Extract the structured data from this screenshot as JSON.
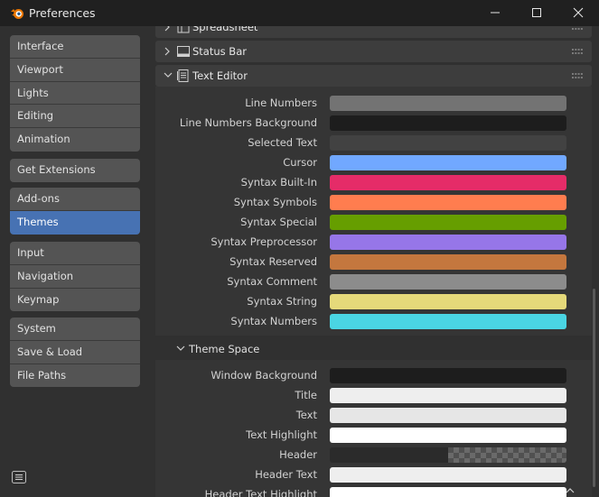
{
  "window": {
    "title": "Preferences"
  },
  "sidebar": {
    "groups": [
      [
        "Interface",
        "Viewport",
        "Lights",
        "Editing",
        "Animation"
      ],
      [
        "Get Extensions"
      ],
      [
        "Add-ons",
        "Themes"
      ],
      [
        "Input",
        "Navigation",
        "Keymap"
      ],
      [
        "System",
        "Save & Load",
        "File Paths"
      ]
    ],
    "active": "Themes"
  },
  "panels": {
    "spreadsheet": {
      "label": "Spreadsheet"
    },
    "status_bar": {
      "label": "Status Bar"
    },
    "text_editor": {
      "label": "Text Editor",
      "rows": [
        {
          "label": "Line Numbers",
          "color": "#737373"
        },
        {
          "label": "Line Numbers Background",
          "color": "#1d1d1d"
        },
        {
          "label": "Selected Text",
          "color": "#424242"
        },
        {
          "label": "Cursor",
          "color": "#71a8ff"
        },
        {
          "label": "Syntax Built-In",
          "color": "#e52c68"
        },
        {
          "label": "Syntax Symbols",
          "color": "#ff7d4f"
        },
        {
          "label": "Syntax Special",
          "color": "#669e00"
        },
        {
          "label": "Syntax Preprocessor",
          "color": "#9676e8"
        },
        {
          "label": "Syntax Reserved",
          "color": "#c4773e"
        },
        {
          "label": "Syntax Comment",
          "color": "#8c8c8c"
        },
        {
          "label": "Syntax String",
          "color": "#e5d97a"
        },
        {
          "label": "Syntax Numbers",
          "color": "#4ad5e3"
        }
      ]
    },
    "theme_space": {
      "label": "Theme Space",
      "rows": [
        {
          "label": "Window Background",
          "color": "#1d1d1d"
        },
        {
          "label": "Title",
          "color": "#eeeeee"
        },
        {
          "label": "Text",
          "color": "#e6e6e6"
        },
        {
          "label": "Text Highlight",
          "color": "#ffffff"
        },
        {
          "label": "Header",
          "color": "#2b2b2b"
        },
        {
          "label": "Header Text",
          "color": "#eeeeee"
        },
        {
          "label": "Header Text Highlight",
          "color": "#ffffff"
        }
      ]
    }
  }
}
